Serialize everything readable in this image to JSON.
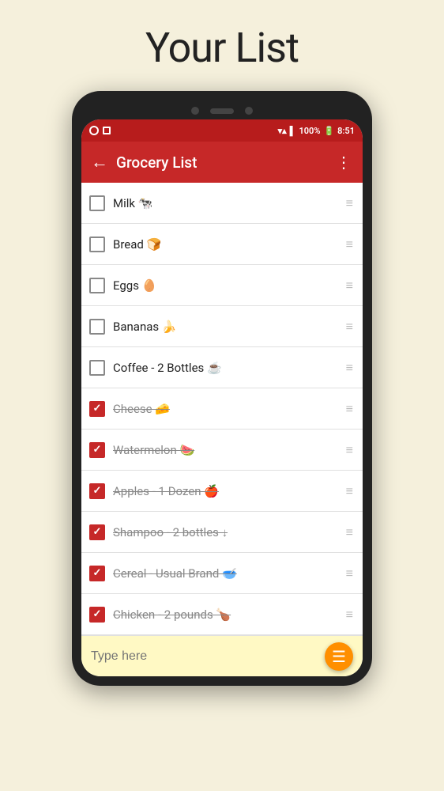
{
  "page": {
    "title": "Your List"
  },
  "statusBar": {
    "battery": "100%",
    "time": "8:51"
  },
  "toolbar": {
    "title": "Grocery List",
    "back": "←",
    "menu": "⋮"
  },
  "items": [
    {
      "id": 1,
      "label": "Milk 🐄",
      "checked": false
    },
    {
      "id": 2,
      "label": "Bread 🍞",
      "checked": false
    },
    {
      "id": 3,
      "label": "Eggs 🥚",
      "checked": false
    },
    {
      "id": 4,
      "label": "Bananas 🍌",
      "checked": false
    },
    {
      "id": 5,
      "label": "Coffee - 2 Bottles ☕",
      "checked": false
    },
    {
      "id": 6,
      "label": "Cheese 🧀",
      "checked": true
    },
    {
      "id": 7,
      "label": "Watermelon 🍉",
      "checked": true
    },
    {
      "id": 8,
      "label": "Apples - 1 Dozen 🍎",
      "checked": true
    },
    {
      "id": 9,
      "label": "Shampoo - 2 bottles ↓",
      "checked": true
    },
    {
      "id": 10,
      "label": "Cereal - Usual Brand 🥣",
      "checked": true
    },
    {
      "id": 11,
      "label": "Chicken - 2 pounds 🍗",
      "checked": true
    }
  ],
  "bottomBar": {
    "placeholder": "Type here",
    "fab_icon": "☰"
  },
  "drag_handle": "≡"
}
